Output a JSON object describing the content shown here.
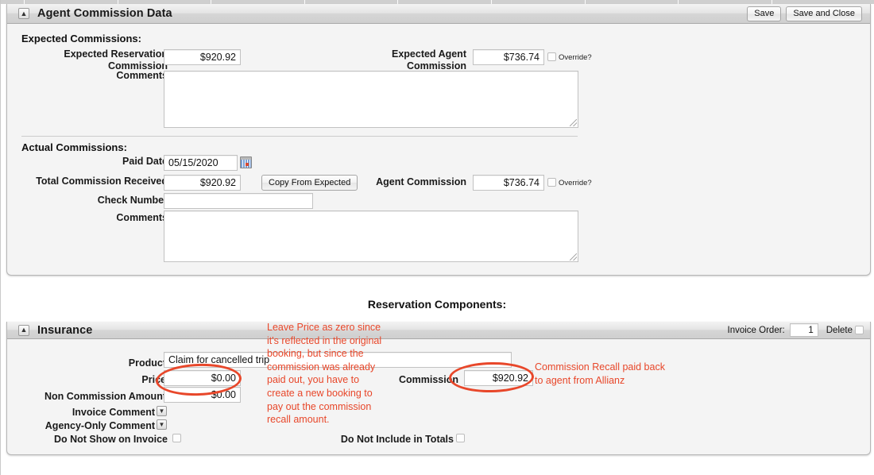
{
  "window": {
    "title": "Agent Commission Data",
    "collapse_icon": "collapse-chevron-up-icon",
    "buttons": [
      {
        "name": "save-button",
        "label": "Save"
      },
      {
        "name": "save-and-close-button",
        "label": "Save and Close"
      }
    ]
  },
  "expected": {
    "heading": "Expected Commissions:",
    "reservation_commission_label": "Expected Reservation\nCommission",
    "reservation_commission_value": "$920.92",
    "agent_commission_label": "Expected Agent\nCommission",
    "agent_commission_value": "$736.74",
    "override_label": "Override?",
    "comments_label": "Comments",
    "comments_value": ""
  },
  "actual": {
    "heading": "Actual Commissions:",
    "paid_date_label": "Paid Date",
    "paid_date_value": "05/15/2020",
    "calendar_icon": "calendar-icon",
    "total_received_label": "Total Commission Received",
    "total_received_value": "$920.92",
    "copy_from_expected_label": "Copy From Expected",
    "agent_commission_label": "Agent Commission",
    "agent_commission_value": "$736.74",
    "override_label": "Override?",
    "check_number_label": "Check Number",
    "check_number_value": "",
    "comments_label": "Comments",
    "comments_value": ""
  },
  "components": {
    "section_title": "Reservation Components:",
    "panel_title": "Insurance",
    "collapse_icon": "collapse-chevron-up-icon",
    "invoice_order_label": "Invoice Order:",
    "invoice_order_value": "1",
    "delete_label": "Delete",
    "fields": {
      "product_label": "Product",
      "product_value": "Claim for cancelled trip",
      "price_label": "Price",
      "price_value": "$0.00",
      "non_commission_label": "Non Commission Amount",
      "non_commission_value": "$0.00",
      "commission_label": "Commission",
      "commission_value": "$920.92",
      "invoice_comment_label": "Invoice Comment",
      "invoice_comment_icon": "chevron-double-down-icon",
      "agency_comment_label": "Agency-Only Comment",
      "agency_comment_icon": "chevron-double-down-icon",
      "do_not_show_label": "Do Not Show on Invoice",
      "do_not_include_label": "Do Not Include in Totals"
    }
  },
  "annotations": {
    "accent_color": "#E8472A",
    "left_note": "Leave Price as zero since\nit's reflected in the original\nbooking, but since the\ncommission was already\npaid out, you have to\ncreate a new booking to\npay out the commission\nrecall amount.",
    "right_note": "Commission Recall paid back\nto agent from Allianz"
  }
}
